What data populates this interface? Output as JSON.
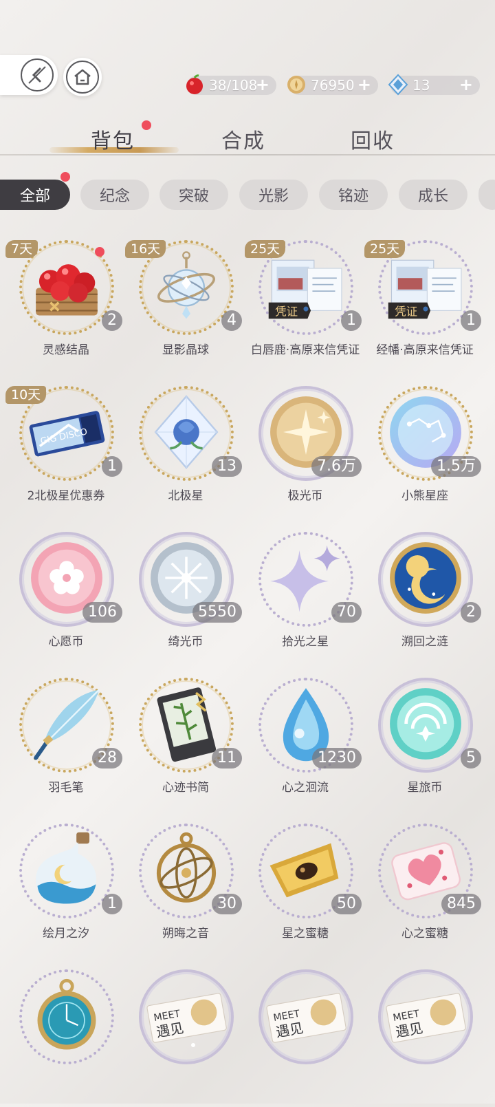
{
  "header": {
    "back_label": "",
    "home_label": ""
  },
  "currencies": [
    {
      "name": "apple-icon",
      "value": "38/108",
      "plus": "+",
      "color": "#d8232a"
    },
    {
      "name": "coin-icon",
      "value": "76950",
      "plus": "+",
      "color": "#d9b06a"
    },
    {
      "name": "diamond-icon",
      "value": "13",
      "plus": "+",
      "color": "#5aa0d8"
    }
  ],
  "tabs": {
    "bag": "背包",
    "synth": "合成",
    "recycle": "回收"
  },
  "chips": [
    "全部",
    "纪念",
    "突破",
    "光影",
    "铭迹",
    "成长"
  ],
  "items": [
    {
      "name": "灵感结晶",
      "count": "2",
      "days": "7天",
      "icon": "apple-basket-icon"
    },
    {
      "name": "显影晶球",
      "count": "4",
      "days": "16天",
      "icon": "crystal-orb-icon"
    },
    {
      "name": "白唇鹿·高原来信凭证",
      "count": "1",
      "days": "25天",
      "icon": "letter-voucher-icon"
    },
    {
      "name": "经幡·高原来信凭证",
      "count": "1",
      "days": "25天",
      "icon": "letter-voucher-icon"
    },
    {
      "name": "2北极星优惠券",
      "count": "1",
      "days": "10天",
      "icon": "ticket-icon"
    },
    {
      "name": "北极星",
      "count": "13",
      "days": "",
      "icon": "crystal-star-icon"
    },
    {
      "name": "极光币",
      "count": "7.6万",
      "days": "",
      "icon": "aurora-coin-icon"
    },
    {
      "name": "小熊星座",
      "count": "1.5万",
      "days": "",
      "icon": "ursa-coin-icon"
    },
    {
      "name": "心愿币",
      "count": "106",
      "days": "",
      "icon": "wish-coin-icon"
    },
    {
      "name": "绮光币",
      "count": "5550",
      "days": "",
      "icon": "silver-coin-icon"
    },
    {
      "name": "拾光之星",
      "count": "70",
      "days": "",
      "icon": "sparkle-icon"
    },
    {
      "name": "溯回之涟",
      "count": "2",
      "days": "",
      "icon": "sun-moon-coin-icon"
    },
    {
      "name": "羽毛笔",
      "count": "28",
      "days": "",
      "icon": "feather-pen-icon"
    },
    {
      "name": "心迹书简",
      "count": "11",
      "days": "",
      "icon": "book-card-icon"
    },
    {
      "name": "心之洄流",
      "count": "1230",
      "days": "",
      "icon": "water-drop-icon"
    },
    {
      "name": "星旅币",
      "count": "5",
      "days": "",
      "icon": "star-travel-coin-icon"
    },
    {
      "name": "绘月之汐",
      "count": "1",
      "days": "",
      "icon": "moon-bottle-icon"
    },
    {
      "name": "朔晦之音",
      "count": "30",
      "days": "",
      "icon": "armillary-icon"
    },
    {
      "name": "星之蜜糖",
      "count": "50",
      "days": "",
      "icon": "gold-candy-icon"
    },
    {
      "name": "心之蜜糖",
      "count": "845",
      "days": "",
      "icon": "heart-candy-icon"
    },
    {
      "name": "",
      "count": "",
      "days": "",
      "icon": "pocket-watch-icon"
    },
    {
      "name": "",
      "count": "",
      "days": "",
      "icon": "meet-ticket-icon",
      "label": "MEET\n遇见"
    },
    {
      "name": "",
      "count": "",
      "days": "",
      "icon": "meet-ticket-icon",
      "label": "MEET\n遇见"
    },
    {
      "name": "",
      "count": "",
      "days": "",
      "icon": "meet-ticket-icon",
      "label": "MEET\n遇见"
    }
  ]
}
